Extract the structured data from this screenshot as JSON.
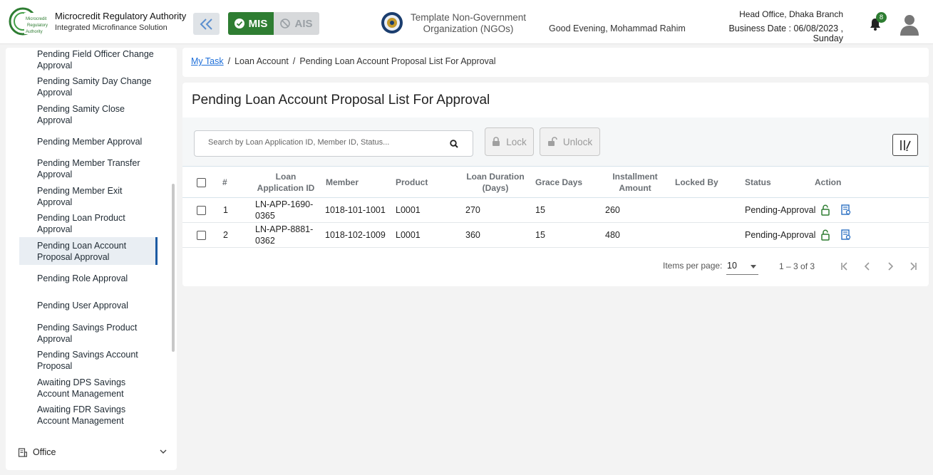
{
  "header": {
    "org_title": "Microcredit Regulatory Authority",
    "org_subtitle": "Integrated Microfinance Solution",
    "logo_text": [
      "Microcredit",
      "Regulatory",
      "Authority"
    ],
    "mis_label": "MIS",
    "ais_label": "AIS",
    "ngo_name": "Template Non-Government Organization (NGOs)",
    "greeting": "Good Evening, Mohammad Rahim",
    "branch": "Head Office, Dhaka Branch",
    "business_date": "Business Date : 06/08/2023 , Sunday",
    "notification_count": "8",
    "accent_color": "#2e7d32"
  },
  "sidebar": {
    "items": [
      {
        "label": "Pending Field Officer Change Approval"
      },
      {
        "label": "Pending Samity Day Change Approval"
      },
      {
        "label": "Pending Samity Close Approval"
      },
      {
        "label": "Pending Member Approval"
      },
      {
        "label": "Pending Member Transfer Approval"
      },
      {
        "label": "Pending Member Exit Approval"
      },
      {
        "label": "Pending Loan Product Approval"
      },
      {
        "label": "Pending Loan Account Proposal Approval"
      },
      {
        "label": "Pending Role Approval"
      },
      {
        "label": "Pending User Approval"
      },
      {
        "label": "Pending Savings Product Approval"
      },
      {
        "label": "Pending Savings Account Proposal"
      },
      {
        "label": "Awaiting DPS Savings Account Management"
      },
      {
        "label": "Awaiting FDR Savings Account Management"
      }
    ],
    "active_item": "Pending Loan Account Proposal Approval",
    "office_label": "Office"
  },
  "breadcrumb": {
    "items": [
      "My Task",
      "Loan Account",
      "Pending Loan Account Proposal List For Approval"
    ],
    "separator": "/"
  },
  "main": {
    "title": "Pending Loan Account Proposal List For Approval",
    "search_placeholder": "Search by Loan Application ID, Member ID, Status...",
    "lock_label": "Lock",
    "unlock_label": "Unlock",
    "columns": {
      "num": "#",
      "loan_app_id": "Loan Application ID",
      "member": "Member",
      "product": "Product",
      "duration": "Loan Duration (Days)",
      "grace": "Grace Days",
      "installment": "Installment Amount",
      "locked_by": "Locked By",
      "status": "Status",
      "action": "Action"
    },
    "rows": [
      {
        "num": "1",
        "loan_app_id": "LN-APP-1690-0365",
        "member": "1018-101-1001",
        "product": "L0001",
        "duration": "270",
        "grace": "15",
        "installment": "260",
        "locked_by": "",
        "status": "Pending-Approval"
      },
      {
        "num": "2",
        "loan_app_id": "LN-APP-8881-0362",
        "member": "1018-102-1009",
        "product": "L0001",
        "duration": "360",
        "grace": "15",
        "installment": "480",
        "locked_by": "",
        "status": "Pending-Approval"
      }
    ],
    "paginator": {
      "items_per_page_label": "Items per page:",
      "items_per_page": "10",
      "range": "1 – 3 of 3"
    }
  }
}
